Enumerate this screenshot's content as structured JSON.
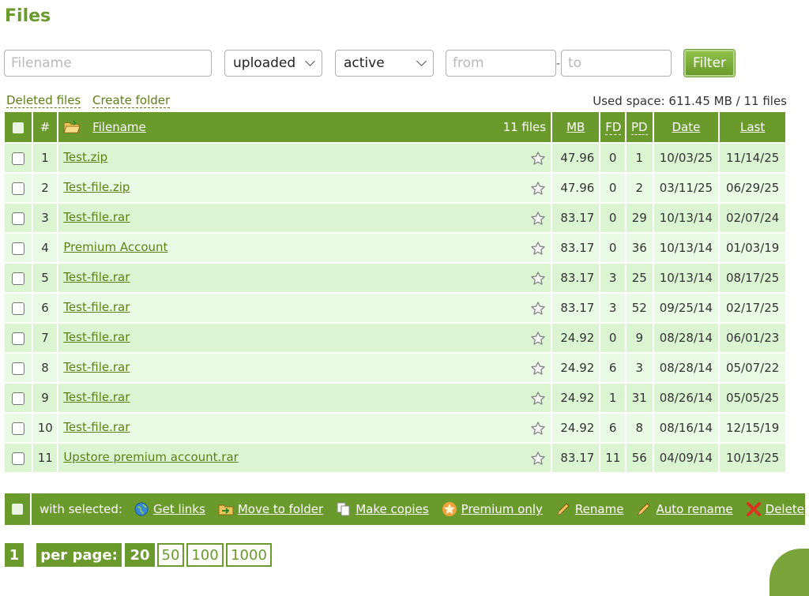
{
  "page": {
    "title": "Files"
  },
  "filters": {
    "filename_placeholder": "Filename",
    "status_select": "uploaded",
    "state_select": "active",
    "from_placeholder": "from",
    "to_placeholder": "to",
    "filter_button": "Filter"
  },
  "links": {
    "deleted_files": "Deleted files",
    "create_folder": "Create folder"
  },
  "used_space": "Used space: 611.45 MB / 11 files",
  "table": {
    "headers": {
      "num": "#",
      "filename": "Filename",
      "count": "11 files",
      "mb": "MB",
      "fd": "FD",
      "pd": "PD",
      "date": "Date",
      "last": "Last"
    },
    "rows": [
      {
        "n": "1",
        "name": "Test.zip",
        "mb": "47.96",
        "fd": "0",
        "pd": "1",
        "date": "10/03/25",
        "last": "11/14/25"
      },
      {
        "n": "2",
        "name": "Test-file.zip",
        "mb": "47.96",
        "fd": "0",
        "pd": "2",
        "date": "03/11/25",
        "last": "06/29/25"
      },
      {
        "n": "3",
        "name": "Test-file.rar",
        "mb": "83.17",
        "fd": "0",
        "pd": "29",
        "date": "10/13/14",
        "last": "02/07/24"
      },
      {
        "n": "4",
        "name": "Premium Account",
        "mb": "83.17",
        "fd": "0",
        "pd": "36",
        "date": "10/13/14",
        "last": "01/03/19"
      },
      {
        "n": "5",
        "name": "Test-file.rar",
        "mb": "83.17",
        "fd": "3",
        "pd": "25",
        "date": "10/13/14",
        "last": "08/17/25"
      },
      {
        "n": "6",
        "name": "Test-file.rar",
        "mb": "83.17",
        "fd": "3",
        "pd": "52",
        "date": "09/25/14",
        "last": "02/17/25"
      },
      {
        "n": "7",
        "name": "Test-file.rar",
        "mb": "24.92",
        "fd": "0",
        "pd": "9",
        "date": "08/28/14",
        "last": "06/01/23"
      },
      {
        "n": "8",
        "name": "Test-file.rar",
        "mb": "24.92",
        "fd": "6",
        "pd": "3",
        "date": "08/28/14",
        "last": "05/07/22"
      },
      {
        "n": "9",
        "name": "Test-file.rar",
        "mb": "24.92",
        "fd": "1",
        "pd": "31",
        "date": "08/26/14",
        "last": "05/05/25"
      },
      {
        "n": "10",
        "name": "Test-file.rar",
        "mb": "24.92",
        "fd": "6",
        "pd": "8",
        "date": "08/16/14",
        "last": "12/15/19"
      },
      {
        "n": "11",
        "name": "Upstore premium account.rar",
        "mb": "83.17",
        "fd": "11",
        "pd": "56",
        "date": "04/09/14",
        "last": "10/13/25"
      }
    ]
  },
  "actions": {
    "with_selected": "with selected:",
    "items": [
      {
        "label": "Get links",
        "icon": "globe-icon"
      },
      {
        "label": "Move to folder",
        "icon": "folder-move-icon"
      },
      {
        "label": "Make copies",
        "icon": "copy-icon"
      },
      {
        "label": "Premium only",
        "icon": "premium-star-icon"
      },
      {
        "label": "Rename",
        "icon": "pencil-icon"
      },
      {
        "label": "Auto rename",
        "icon": "pencil-icon"
      },
      {
        "label": "Delete",
        "icon": "delete-x-icon"
      }
    ]
  },
  "paging": {
    "current_page": "1",
    "per_page_label": "per page:",
    "per_page_options": [
      "20",
      "50",
      "100",
      "1000"
    ],
    "per_page_selected": "20"
  },
  "colors": {
    "accent": "#6a9a2c",
    "row_alt_1": "#dbf5d3",
    "row_alt_2": "#e9fbe4",
    "link": "#5e7f16"
  }
}
